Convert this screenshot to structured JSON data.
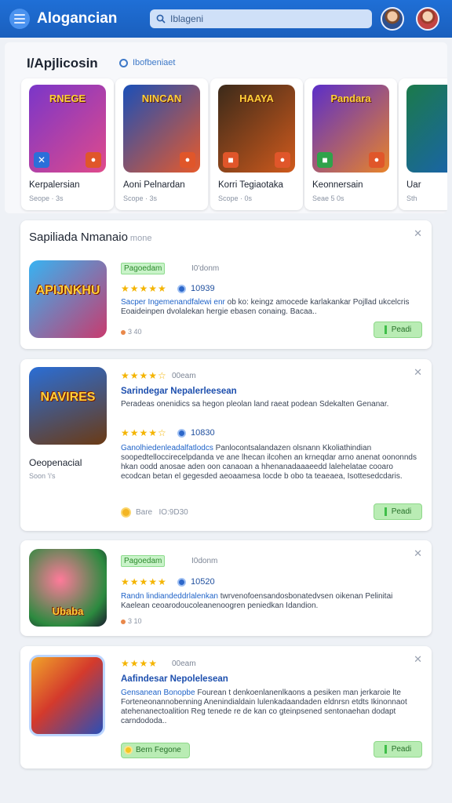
{
  "header": {
    "app_title": "Alogancian",
    "search_value": "Iblageni"
  },
  "featured": {
    "title": "I/Apjlicosin",
    "link": "Ibofbeniaet",
    "cards": [
      {
        "art_text": "RNEGE",
        "name": "Kerpalersian",
        "sub": "Seope · 3s",
        "colors": [
          "#7a36c9",
          "#e04a8b"
        ]
      },
      {
        "art_text": "NINCAN",
        "name": "Aoni Pelnardan",
        "sub": "Scope · 3s",
        "colors": [
          "#1a4fb8",
          "#e75a2b"
        ]
      },
      {
        "art_text": "HAAYA",
        "name": "Korri Tegiaotaka",
        "sub": "Scope · 0s",
        "colors": [
          "#3b2a1a",
          "#d05a1c"
        ]
      },
      {
        "art_text": "Pandara",
        "name": "Keonnersain",
        "sub": "Seae 5 0s",
        "colors": [
          "#5b2ec9",
          "#e8842a"
        ]
      },
      {
        "art_text": "",
        "name": "Uar",
        "sub": "Sth",
        "colors": [
          "#1b7a4a",
          "#1a5fbd"
        ]
      }
    ]
  },
  "list": {
    "section_title": "Sapiliada Nmanaio",
    "section_sub": "mone",
    "items": [
      {
        "icon_text": "APIJNKHU",
        "tag": "Pagoedam",
        "meta": "I0'donm",
        "stars": "★★★★★",
        "score": "10939",
        "description_hl": "Sacper Ingemenandfalewi enr",
        "description": "ob ko: keingz amocede karlakankar Pojllad ukcelcris Eoaideinpen dvolalekan hergie ebasen conaing. Bacaa..",
        "extras": "3 40",
        "button": "Peadi"
      },
      {
        "icon_text": "NAVIRES",
        "stars": "★★★★☆",
        "meta": "00eam",
        "title": "Sarindegar Nepalerleesean",
        "subtitle": "Peradeas onenidics sa hegon pleolan land raeat podean Sdekalten Genanar.",
        "score": "10830",
        "description_hl": "Ganolhiedenleadalfatlodcs",
        "description": "Panlocontsalandazen olsnann Kkoliathindian soopedtelloccirecelpdanda ve ane lhecan ilcohen an krneqdar arno anenat oononnds hkan oodd anosae aden oon canaoan a hhenanadaaaeedd lalehelatae cooaro ecodcan betan el gegesded aeoaamesa Iocde b obo ta teaeaea, Isottesedcdaris.",
        "side_name": "Oeopenacial",
        "side_sub": "Soon 'i's",
        "extras_label": "Bare",
        "extras_value": "IO:9D30",
        "button": "Peadi"
      },
      {
        "icon_text": "Ubaba",
        "tag": "Pagoedam",
        "meta": "I0donm",
        "stars": "★★★★★",
        "score": "10520",
        "description_hl": "Randn lindiandeddrlalenkan",
        "description": "twrvenofoensandosbonatedvsen oikenan Pelinitai Kaelean ceoarodoucoleanenoogren peniedkan Idandion.",
        "extras": "3 10",
        "button": null
      },
      {
        "icon_text": "",
        "stars": "★★★★",
        "meta": "00eam",
        "title": "Aafindesar Nepolelesean",
        "description_hl": "Gensanean Bonopbe",
        "description": "Fourean t denkoenlanenlkaons a pesiken man jerkaroie lte Forteneonannobenning Anenindialdain lulenkadaandaden eldnrsn etdts Ikinonnaot atehenanectoalition Reg tenede re de kan co gteinpsened sentonaehan dodapt carndododa..",
        "chip": "Bern Fegone",
        "button": "Peadi"
      }
    ]
  }
}
